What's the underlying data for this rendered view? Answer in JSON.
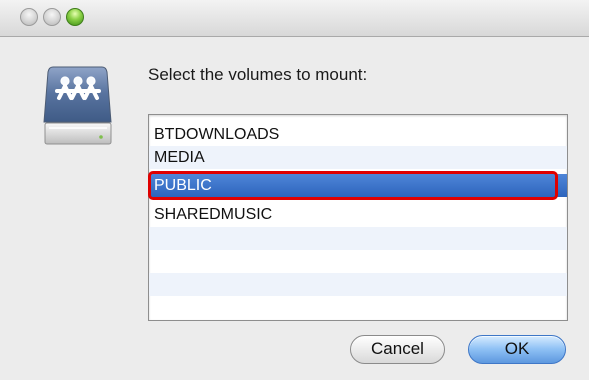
{
  "window": {
    "clipped_title": "",
    "colors": {
      "zoom_button": "#63b52f",
      "selection": "#3b73ca",
      "highlight_outline": "#e00000"
    }
  },
  "dialog": {
    "icon": "shared-server-icon",
    "prompt": "Select the volumes to mount:",
    "selected_volume": "PUBLIC",
    "volumes": [
      {
        "name": "BTDOWNLOADS",
        "selected": false
      },
      {
        "name": "MEDIA",
        "selected": false
      },
      {
        "name": "PUBLIC",
        "selected": true
      },
      {
        "name": "SHAREDMUSIC",
        "selected": false
      }
    ],
    "buttons": {
      "cancel": "Cancel",
      "ok": "OK"
    }
  }
}
